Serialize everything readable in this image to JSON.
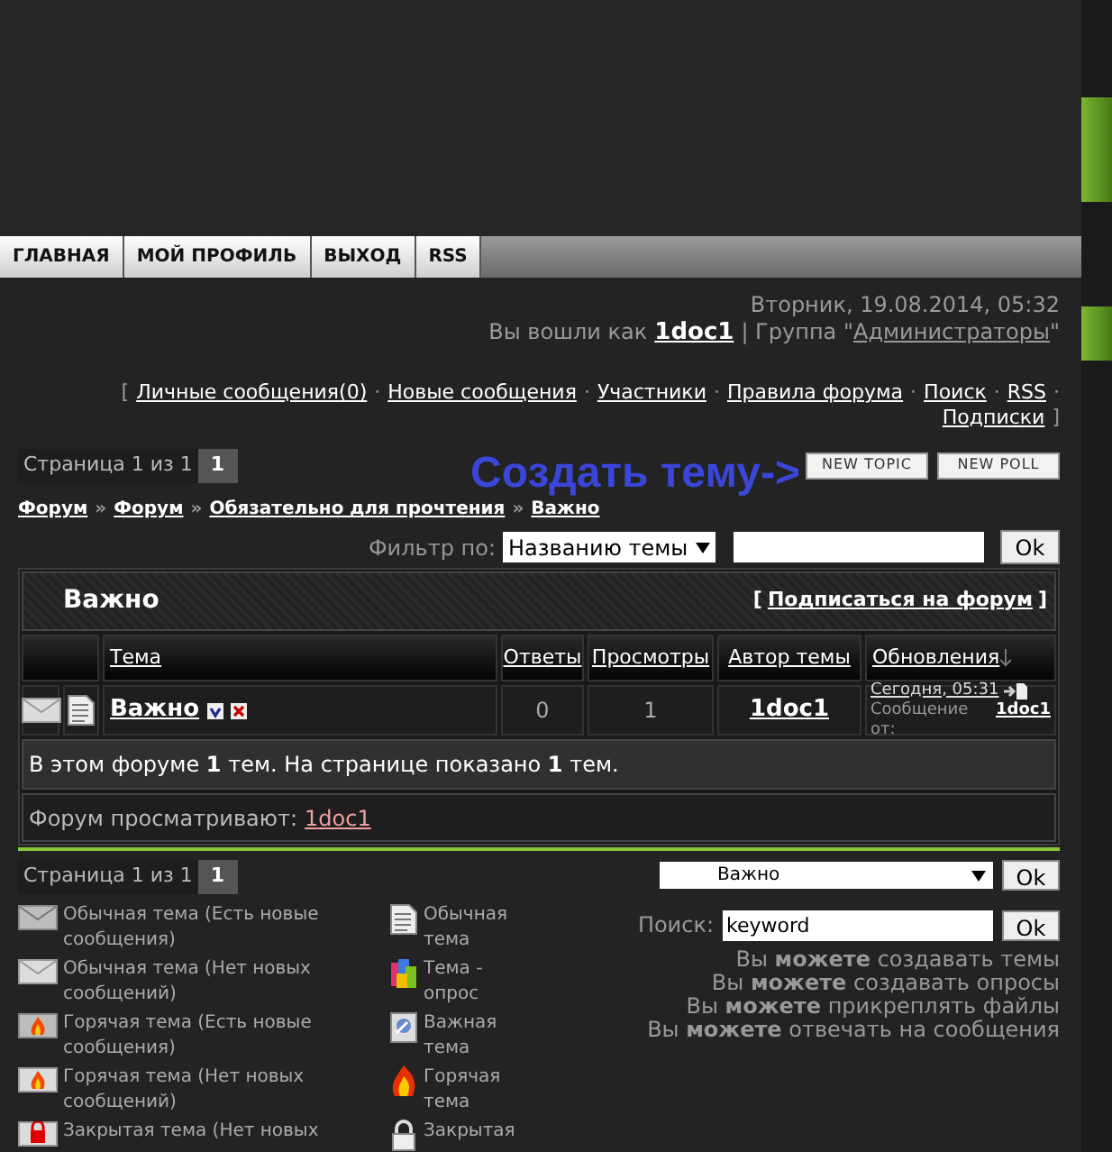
{
  "nav": {
    "tabs": [
      "ГЛАВНАЯ",
      "МОЙ ПРОФИЛЬ",
      "ВЫХОД",
      "RSS"
    ]
  },
  "header": {
    "date": "Вторник, 19.08.2014, 05:32",
    "login_prefix": "Вы вошли как",
    "user": "1doc1",
    "group_prefix": "| Группа \"",
    "group": "Администраторы",
    "group_suffix": "\""
  },
  "links": {
    "open": "[",
    "close": "]",
    "separator": "·",
    "items": [
      "Личные сообщения(0)",
      "Новые сообщения",
      "Участники",
      "Правила форума",
      "Поиск",
      "RSS",
      "Подписки"
    ]
  },
  "pagination_top": {
    "label": "Страница 1 из 1",
    "page": "1"
  },
  "create_hint": "Создать тему->",
  "action_buttons": [
    "NEW TOPIC",
    "NEW POLL"
  ],
  "breadcrumbs": {
    "separator": "»",
    "items": [
      "Форум",
      "Форум",
      "Обязательно для прочтения",
      "Важно"
    ]
  },
  "filter": {
    "label": "Фильтр по:",
    "select": "Названию темы",
    "button": "Ok"
  },
  "forum": {
    "title": "Важно",
    "open": "[",
    "subscribe": "Подписаться на форум",
    "close": "]"
  },
  "columns": [
    "Тема",
    "Ответы",
    "Просмотры",
    "Автор темы",
    "Обновления"
  ],
  "rows": [
    {
      "title": "Важно",
      "replies": "0",
      "views": "1",
      "author": "1doc1",
      "updated": "Сегодня, 05:31",
      "last_by_label": "Сообщение от:",
      "last_by": "1doc1"
    }
  ],
  "summary": "В этом форуме **1** тем. На странице показано **1** тем.",
  "viewers": {
    "label": "Форум просматривают:",
    "names": [
      "1doc1"
    ]
  },
  "pagination_bottom": {
    "label": "Страница 1 из 1",
    "page": "1"
  },
  "jump": {
    "select": "Важно",
    "button": "Ok"
  },
  "search": {
    "label": "Поиск:",
    "value": "keyword",
    "button": "Ok"
  },
  "permissions": [
    "Вы **можете** создавать темы",
    "Вы **можете** создавать опросы",
    "Вы **можете** прикреплять файлы",
    "Вы **можете** отвечать на сообщения"
  ],
  "legend_left": [
    {
      "kind": "mail-new",
      "text": "Обычная тема (Есть новые сообщения)"
    },
    {
      "kind": "mail",
      "text": "Обычная тема (Нет новых сообщений)"
    },
    {
      "kind": "hot-new",
      "text": "Горячая тема (Есть новые сообщения)"
    },
    {
      "kind": "hot",
      "text": "Горячая тема (Нет новых сообщений)"
    },
    {
      "kind": "locked",
      "text": "Закрытая тема (Нет новых"
    }
  ],
  "legend_right": [
    {
      "kind": "doc",
      "text": "Обычная тема"
    },
    {
      "kind": "poll",
      "text": "Тема - опрос"
    },
    {
      "kind": "pinned",
      "text": "Важная тема"
    },
    {
      "kind": "fire",
      "text": "Горячая тема"
    },
    {
      "kind": "lock",
      "text": "Закрытая"
    }
  ]
}
